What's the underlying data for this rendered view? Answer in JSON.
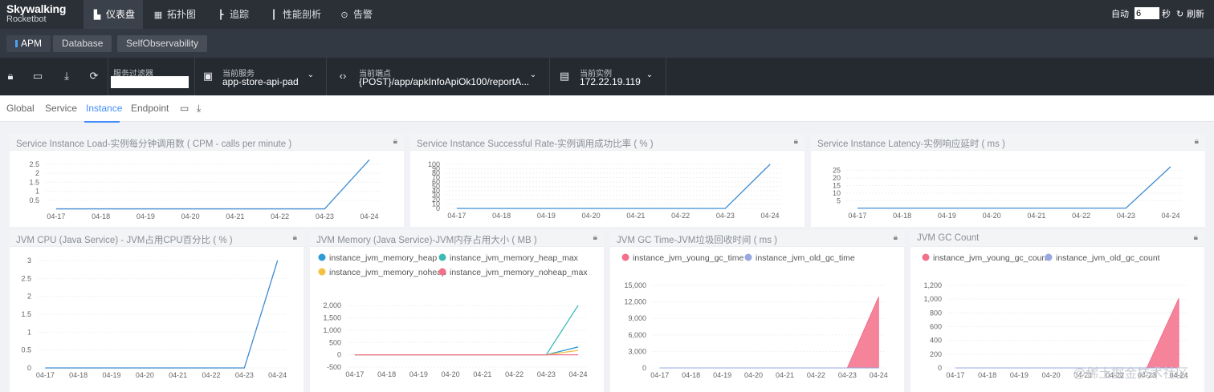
{
  "app": {
    "logo_line1": "Skywalking",
    "logo_line2": "Rocketbot"
  },
  "nav": [
    {
      "label": "仪表盘",
      "icon": "dashboard-icon",
      "glyph": "▙"
    },
    {
      "label": "拓扑图",
      "icon": "topology-icon",
      "glyph": "▦"
    },
    {
      "label": "追踪",
      "icon": "trace-icon",
      "glyph": "┣"
    },
    {
      "label": "性能剖析",
      "icon": "profile-icon",
      "glyph": "┃"
    },
    {
      "label": "告警",
      "icon": "alarm-icon",
      "glyph": "⊙"
    }
  ],
  "auto_refresh": {
    "label": "自动",
    "interval_value": "6",
    "unit": "秒",
    "refresh_label": "刷新"
  },
  "layers": [
    {
      "label": "APM"
    },
    {
      "label": "Database"
    },
    {
      "label": "SelfObservability"
    }
  ],
  "toolbar": {
    "filter_label": "服务过滤器",
    "service_label": "当前服务",
    "service_value": "app-store-api-pad",
    "endpoint_label": "当前端点",
    "endpoint_value": "{POST}/app/apkInfoApiOk100/reportA...",
    "instance_label": "当前实例",
    "instance_value": "172.22.19.119"
  },
  "tabs": [
    {
      "label": "Global"
    },
    {
      "label": "Service"
    },
    {
      "label": "Instance"
    },
    {
      "label": "Endpoint"
    }
  ],
  "watermark": "@稀土掘金技术社区",
  "panels": {
    "load": {
      "title": "Service Instance Load-实例每分钟调用数 ( CPM - calls per minute )"
    },
    "success": {
      "title": "Service Instance Successful Rate-实例调用成功比率 ( % )"
    },
    "latency": {
      "title": "Service Instance Latency-实例响应延时 ( ms )"
    },
    "cpu": {
      "title": "JVM CPU (Java Service) - JVM占用CPU百分比 ( % )"
    },
    "memory": {
      "title": "JVM Memory (Java Service)-JVM内存占用大小 ( MB )"
    },
    "gctime": {
      "title": "JVM GC Time-JVM垃圾回收时间 ( ms )"
    },
    "gccount": {
      "title": "JVM GC Count"
    }
  },
  "chart_data": [
    {
      "id": "load",
      "type": "line",
      "x": [
        "04-17",
        "04-18",
        "04-19",
        "04-20",
        "04-21",
        "04-22",
        "04-23",
        "04-24"
      ],
      "yticks": [
        "0.5",
        "1",
        "1.5",
        "2",
        "2.5"
      ],
      "ylim": [
        0,
        2.9
      ],
      "series": [
        {
          "color": "#3f8bd1",
          "values": [
            0.02,
            0.02,
            0.02,
            0.02,
            0.02,
            0.02,
            0.02,
            2.75
          ]
        }
      ]
    },
    {
      "id": "success",
      "type": "line",
      "x": [
        "04-17",
        "04-18",
        "04-19",
        "04-20",
        "04-21",
        "04-22",
        "04-23",
        "04-24"
      ],
      "yticks": [
        "0",
        "10",
        "20",
        "30",
        "40",
        "50",
        "60",
        "70",
        "80",
        "90",
        "100"
      ],
      "ylim": [
        0,
        100
      ],
      "series": [
        {
          "color": "#3f8bd1",
          "values": [
            0,
            0,
            0,
            0,
            0,
            0,
            0,
            100
          ]
        }
      ]
    },
    {
      "id": "latency",
      "type": "line",
      "x": [
        "04-17",
        "04-18",
        "04-19",
        "04-20",
        "04-21",
        "04-22",
        "04-23",
        "04-24"
      ],
      "yticks": [
        "5",
        "10",
        "15",
        "20",
        "25"
      ],
      "ylim": [
        0,
        29
      ],
      "series": [
        {
          "color": "#3f8bd1",
          "values": [
            0.2,
            0.2,
            0.2,
            0.2,
            0.2,
            0.2,
            0.2,
            27.5
          ]
        }
      ]
    },
    {
      "id": "cpu",
      "type": "line",
      "x": [
        "04-17",
        "04-18",
        "04-19",
        "04-20",
        "04-21",
        "04-22",
        "04-23",
        "04-24"
      ],
      "yticks": [
        "0",
        "0.5",
        "1",
        "1.5",
        "2",
        "2.5",
        "3"
      ],
      "ylim": [
        0,
        3
      ],
      "series": [
        {
          "color": "#3f8bd1",
          "values": [
            0,
            0,
            0,
            0,
            0,
            0,
            0,
            3
          ]
        }
      ]
    },
    {
      "id": "memory",
      "type": "line",
      "x": [
        "04-17",
        "04-18",
        "04-19",
        "04-20",
        "04-21",
        "04-22",
        "04-23",
        "04-24"
      ],
      "yticks": [
        "-500",
        "0",
        "500",
        "1,000",
        "1,500",
        "2,000"
      ],
      "ylim": [
        -500,
        2300
      ],
      "series": [
        {
          "name": "instance_jvm_memory_heap",
          "color": "#2e9bd6",
          "values": [
            0,
            0,
            0,
            0,
            0,
            0,
            0,
            320
          ]
        },
        {
          "name": "instance_jvm_memory_heap_max",
          "color": "#3dbbb3",
          "values": [
            0,
            0,
            0,
            0,
            0,
            0,
            0,
            2010
          ]
        },
        {
          "name": "instance_jvm_memory_noheap",
          "color": "#f5c042",
          "values": [
            0,
            0,
            0,
            0,
            0,
            0,
            0,
            180
          ]
        },
        {
          "name": "instance_jvm_memory_noheap_max",
          "color": "#f36f8a",
          "values": [
            0,
            0,
            0,
            0,
            0,
            0,
            0,
            0
          ]
        }
      ]
    },
    {
      "id": "gctime",
      "type": "area",
      "x": [
        "04-17",
        "04-18",
        "04-19",
        "04-20",
        "04-21",
        "04-22",
        "04-23",
        "04-24"
      ],
      "yticks": [
        "0",
        "3,000",
        "6,000",
        "9,000",
        "12,000",
        "15,000"
      ],
      "ylim": [
        0,
        15000
      ],
      "series": [
        {
          "name": "instance_jvm_young_gc_time",
          "color": "#f36f8a",
          "values": [
            0,
            0,
            0,
            0,
            0,
            0,
            0,
            12900
          ]
        },
        {
          "name": "instance_jvm_old_gc_time",
          "color": "#98a8e0",
          "values": [
            0,
            0,
            0,
            0,
            0,
            0,
            0,
            0
          ]
        }
      ]
    },
    {
      "id": "gccount",
      "type": "area",
      "x": [
        "04-17",
        "04-18",
        "04-19",
        "04-20",
        "04-21",
        "04-22",
        "04-23",
        "04-24"
      ],
      "yticks": [
        "0",
        "200",
        "400",
        "600",
        "800",
        "1,000",
        "1,200"
      ],
      "ylim": [
        0,
        1200
      ],
      "series": [
        {
          "name": "instance_jvm_young_gc_count",
          "color": "#f36f8a",
          "values": [
            0,
            0,
            0,
            0,
            0,
            0,
            0,
            1010
          ]
        },
        {
          "name": "instance_jvm_old_gc_count",
          "color": "#98a8e0",
          "values": [
            0,
            0,
            0,
            0,
            0,
            0,
            0,
            0
          ]
        }
      ]
    }
  ]
}
